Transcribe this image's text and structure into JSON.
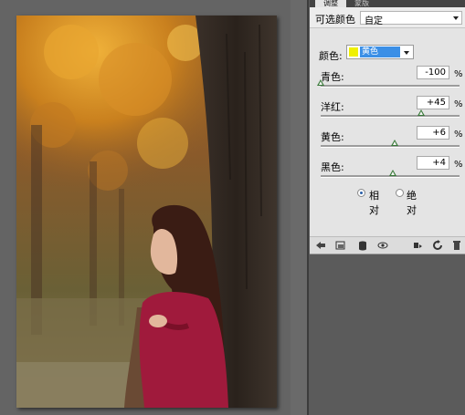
{
  "panel": {
    "tabs": [
      "调整",
      "蒙版"
    ],
    "title": "可选颜色",
    "preset": "自定",
    "color_label": "颜色:",
    "color_value": "黄色",
    "color_swatch": "#f0f000",
    "sliders": [
      {
        "label": "青色:",
        "value": "-100",
        "unit": "%",
        "fraction": 0.0
      },
      {
        "label": "洋红:",
        "value": "+45",
        "unit": "%",
        "fraction": 0.725
      },
      {
        "label": "黄色:",
        "value": "+6",
        "unit": "%",
        "fraction": 0.53
      },
      {
        "label": "黑色:",
        "value": "+4",
        "unit": "%",
        "fraction": 0.52
      }
    ],
    "method": {
      "relative_label": "相对",
      "absolute_label": "绝对",
      "selected": "relative"
    },
    "toolbar_icons": [
      "back-arrow-icon",
      "clip-layer-icon",
      "visibility-eye-icon",
      "view-previous-icon",
      "reset-icon",
      "refresh-icon",
      "trash-icon"
    ]
  },
  "photo": {
    "description_icon": "image-canvas",
    "accent_colors": {
      "leaves": "#d58a1c",
      "sweater": "#a01a3c",
      "trunk": "#2e2620"
    }
  }
}
